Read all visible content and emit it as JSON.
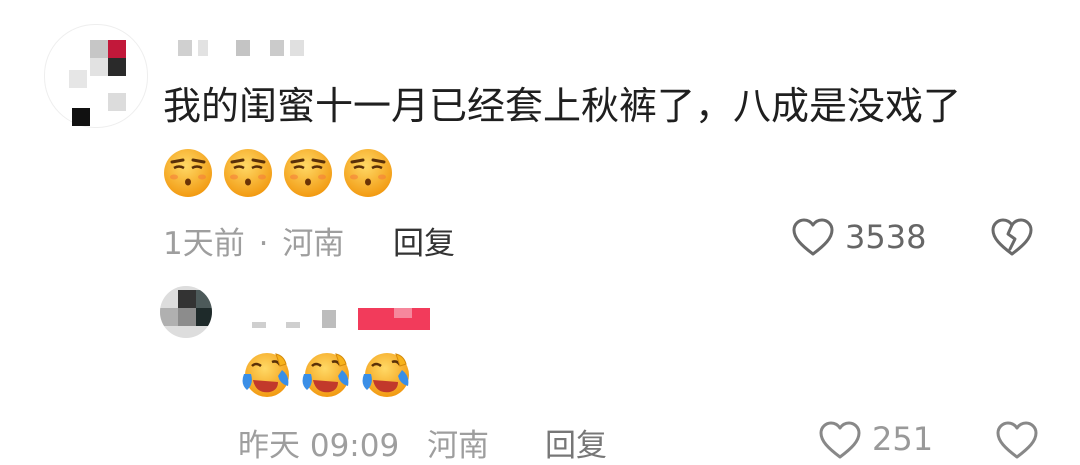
{
  "comment": {
    "text": "我的闺蜜十一月已经套上秋裤了，八成是没戏了",
    "emojis": [
      "smirk-face-emoji",
      "smirk-face-emoji",
      "smirk-face-emoji",
      "smirk-face-emoji"
    ],
    "time": "1天前",
    "separator": "·",
    "location": "河南",
    "reply_label": "回复",
    "like_count": "3538"
  },
  "reply": {
    "emojis": [
      "laughing-crying-emoji",
      "laughing-crying-emoji",
      "laughing-crying-emoji"
    ],
    "time": "昨天 09:09",
    "location": "河南",
    "reply_label": "回复",
    "like_count": "251"
  },
  "colors": {
    "text": "#1f1f1f",
    "meta": "#9e9e9e",
    "author_badge": "#f23b5b",
    "emoji_yellow": "#f7b21b"
  }
}
